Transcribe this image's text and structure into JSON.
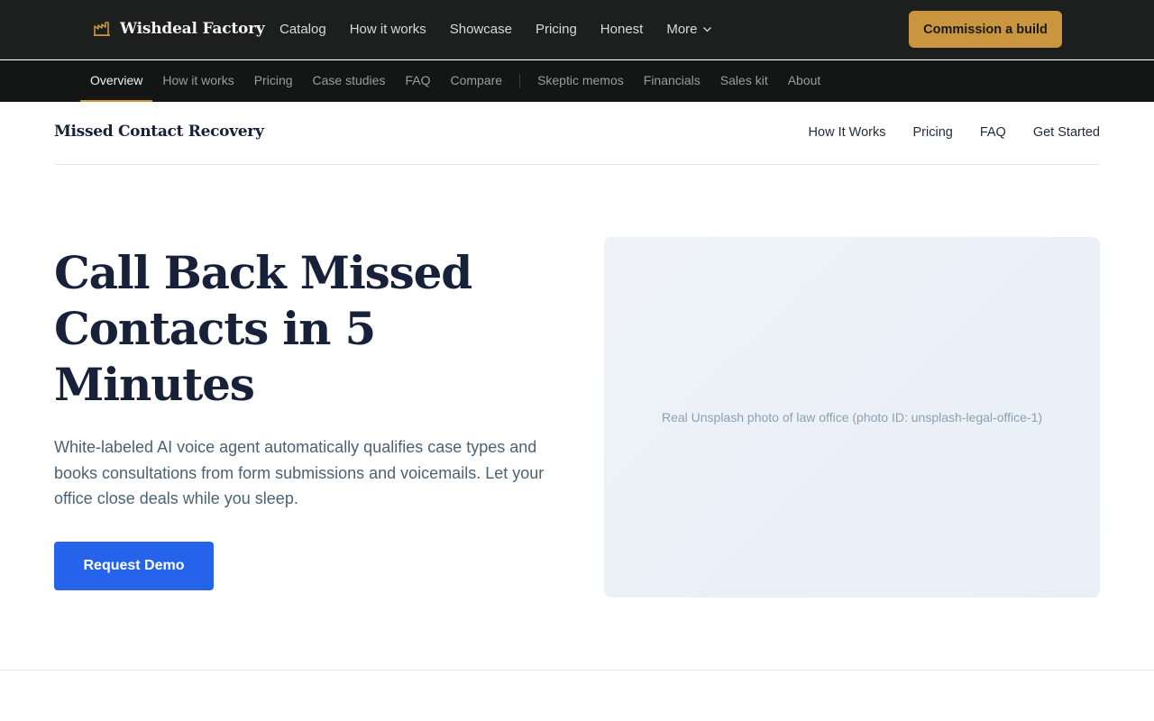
{
  "topbar": {
    "brand": {
      "icon": "factory-icon",
      "name": "Wishdeal Factory"
    },
    "nav": [
      {
        "label": "Catalog"
      },
      {
        "label": "How it works"
      },
      {
        "label": "Showcase"
      },
      {
        "label": "Pricing"
      },
      {
        "label": "Honest"
      },
      {
        "label": "More",
        "icon": "chevron-down-icon"
      }
    ],
    "cta_label": "Commission a build"
  },
  "subnav": {
    "items": [
      {
        "label": "Overview",
        "active": true
      },
      {
        "label": "How it works"
      },
      {
        "label": "Pricing"
      },
      {
        "label": "Case studies"
      },
      {
        "label": "FAQ"
      },
      {
        "label": "Compare"
      },
      {
        "label": "Skeptic memos"
      },
      {
        "label": "Financials"
      },
      {
        "label": "Sales kit"
      },
      {
        "label": "About"
      }
    ]
  },
  "site": {
    "logo": "Missed Contact Recovery",
    "nav": [
      {
        "label": "How It Works"
      },
      {
        "label": "Pricing"
      },
      {
        "label": "FAQ"
      },
      {
        "label": "Get Started"
      }
    ]
  },
  "hero": {
    "title": "Call Back Missed Contacts in 5 Minutes",
    "subtitle": "White-labeled AI voice agent automatically qualifies case types and books consultations from form submissions and voicemails. Let your office close deals while you sleep.",
    "cta_label": "Request Demo",
    "image_caption": "Real Unsplash photo of law office (photo ID: unsplash-legal-office-1)"
  },
  "colors": {
    "topbar_bg": "#1d1f1e",
    "subbar_bg": "#141615",
    "accent_gold": "#c9953f",
    "primary_blue": "#2563eb",
    "heading_navy": "#17213a"
  }
}
